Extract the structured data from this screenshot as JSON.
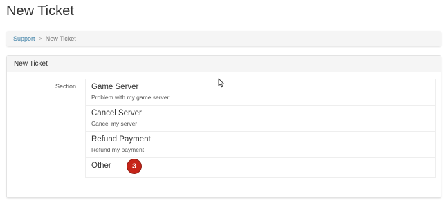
{
  "page": {
    "title": "New Ticket"
  },
  "breadcrumb": {
    "items": [
      "Support",
      "New Ticket"
    ],
    "separator": ">"
  },
  "panel": {
    "heading": "New Ticket",
    "field_label": "Section",
    "options": [
      {
        "title": "Game Server",
        "description": "Problem with my game server"
      },
      {
        "title": "Cancel Server",
        "description": "Cancel my server"
      },
      {
        "title": "Refund Payment",
        "description": "Refund my payment"
      },
      {
        "title": "Other",
        "description": ""
      }
    ]
  },
  "annotation": {
    "step_number": "3",
    "color": "#c62418"
  },
  "icons": {
    "cursor": "mouse-pointer-icon"
  }
}
